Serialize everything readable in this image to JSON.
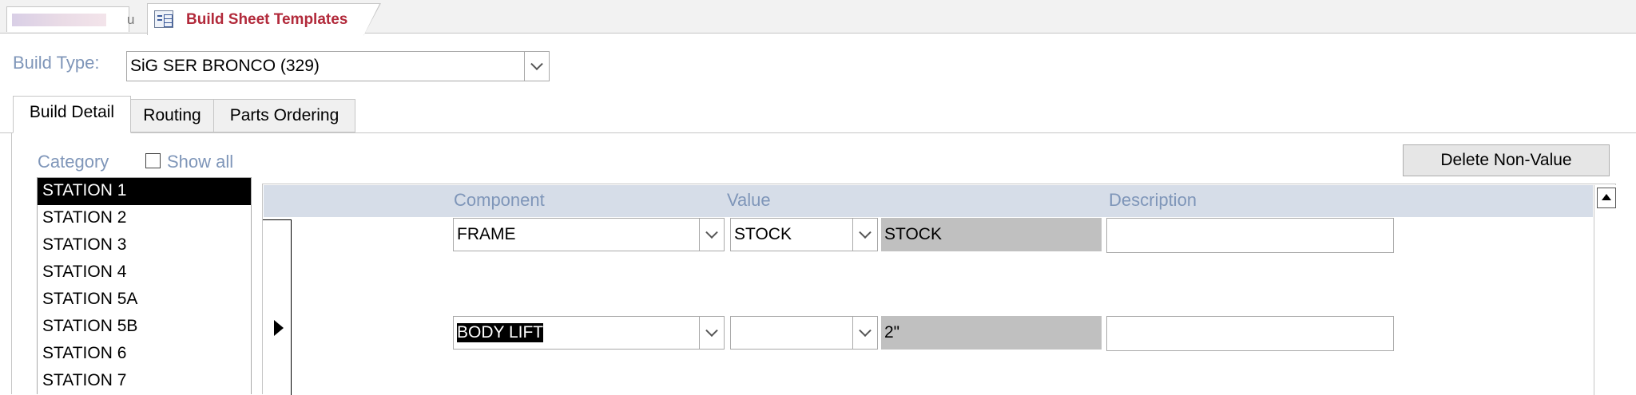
{
  "doc_tabs": {
    "hidden_tab_tail": "u",
    "active_tab_title": "Build Sheet Templates"
  },
  "build_type": {
    "label": "Build Type:",
    "value": "SiG SER BRONCO (329)"
  },
  "form_tabs": [
    "Build Detail",
    "Routing",
    "Parts Ordering"
  ],
  "category": {
    "label": "Category",
    "show_all_label": "Show all",
    "show_all_checked": false,
    "items": [
      "STATION 1",
      "STATION 2",
      "STATION 3",
      "STATION 4",
      "STATION 5A",
      "STATION 5B",
      "STATION 6",
      "STATION 7"
    ],
    "selected": "STATION 1"
  },
  "delete_button_label": "Delete Non-Value",
  "grid": {
    "headers": {
      "component": "Component",
      "value": "Value",
      "description": "Description"
    },
    "rows": [
      {
        "component": "FRAME",
        "value": "STOCK",
        "value_display": "STOCK",
        "description": ""
      },
      {
        "component": "BODY LIFT",
        "value": "",
        "value_display": "2\"",
        "description": ""
      }
    ]
  },
  "colors": {
    "doc_tab_title": "#b22a3b",
    "label_blue": "#7f96b9",
    "subform_header": "#d6dde8",
    "selection": "#000000"
  }
}
